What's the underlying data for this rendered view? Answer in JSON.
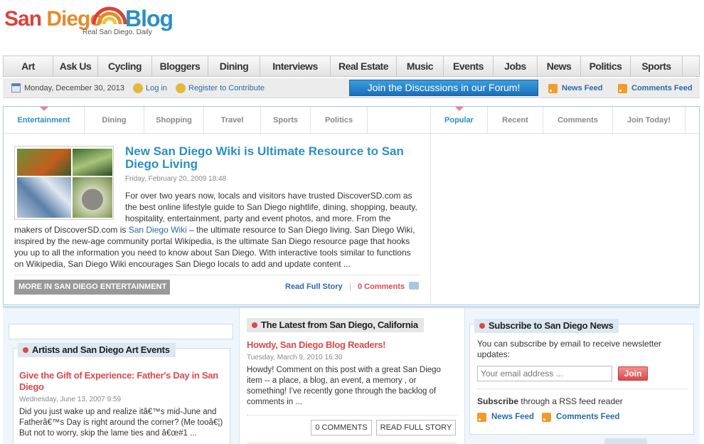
{
  "logo": {
    "part1": "San ",
    "part2": "Diego",
    "part3": "Blog",
    "tagline": "Real San Diego. Daily"
  },
  "nav": {
    "items": [
      "Art",
      "Ask Us",
      "Cycling",
      "Bloggers",
      "Dining",
      "Interviews",
      "Real Estate",
      "Music",
      "Events",
      "Jobs",
      "News",
      "Politics",
      "Sports"
    ]
  },
  "util": {
    "date": "Monday, December 30, 2013",
    "login": "Log in",
    "register": "Register to Contribute",
    "forum": "Join the Discussions in our Forum!",
    "news_feed": "News Feed",
    "comments_feed": "Comments Feed"
  },
  "featured": {
    "tabs_left": [
      "Entertainment",
      "Dining",
      "Shopping",
      "Travel",
      "Sports",
      "Politics"
    ],
    "tabs_right": [
      "Popular",
      "Recent",
      "Comments",
      "Join Today!"
    ],
    "title": "New San Diego Wiki is Ultimate Resource to San Diego Living",
    "date": "Friday, February 20, 2009 18:48",
    "body_first": "For over two years now, locals and visitors have trusted DiscoverSD.com as the best online lifestyle guide to San Diego nightlife, dining, shopping, beauty, hospitality, entertainment, party and event photos, and more. From the",
    "body_pre_link": "makers of DiscoverSD.com is ",
    "body_link": "San Diego Wiki",
    "body_rest": " – the ultimate resource to San Diego living. San Diego Wiki, inspired by the new-age community portal Wikipedia, is the ultimate San Diego resource page that hooks you up to all the information you need to know about San Diego. With interactive tools similar to functions on Wikipedia, San Diego Wiki encourages San Diego locals to add and update content ...",
    "more": "MORE IN SAN DIEGO ENTERTAINMENT",
    "read_full": "Read Full Story",
    "separator": "|",
    "comments": "0 Comments"
  },
  "art_box": {
    "head": "Artists and San Diego Art Events",
    "title": "Give the Gift of Experience: Father's Day in San Diego",
    "date": "Wednesday, June 13, 2007 9:59",
    "body": "Did you just wake up and realize itâ€™s mid-June and Fatherâ€™s Day is right around the corner? (Me tooâ€¦) But not to worry, skip the lame ties and â€œ#1 ..."
  },
  "latest": {
    "head": "The Latest from San Diego, California",
    "title": "Howdy, San Diego Blog Readers!",
    "date": "Tuesday, March 9, 2010 16:30",
    "body": "Howdy! Comment on this post with a great San Diego item -- a place, a blog, an event, a memory , or something! I've recently gone through the backlog of comments in ...",
    "comments_btn": "0 COMMENTS",
    "read_btn": "READ FULL STORY"
  },
  "subscribe": {
    "head": "Subscribe to San Diego News",
    "desc": "You can subscribe by email to receive newsletter updates:",
    "email_placeholder": "Your email address ...",
    "join": "Join",
    "rss_strong": "Subscribe",
    "rss_rest": " through a RSS feed reader",
    "news_feed": "News Feed",
    "comments_feed": "Comments Feed"
  },
  "colors": {
    "accent_blue": "#2b8fc4",
    "link_blue": "#2b6aa8",
    "accent_red": "#d94a4a"
  }
}
